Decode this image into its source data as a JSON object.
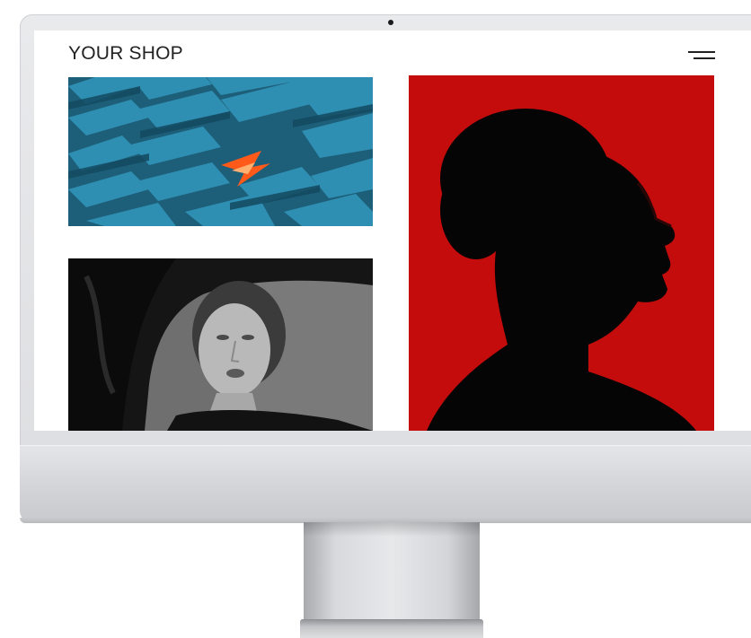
{
  "site": {
    "title": "YOUR SHOP"
  },
  "header": {
    "menu_icon": "hamburger-menu-icon"
  },
  "gallery": {
    "items": [
      {
        "name": "blue-architecture-image",
        "kind": "photo"
      },
      {
        "name": "woman-portrait-image",
        "kind": "photo"
      },
      {
        "name": "man-silhouette-image",
        "kind": "photo"
      }
    ]
  },
  "colors": {
    "background": "#ffffff",
    "text": "#222222",
    "accent_red": "#c50c0c",
    "accent_blue": "#1f6a86",
    "accent_orange": "#ff5a1a"
  }
}
